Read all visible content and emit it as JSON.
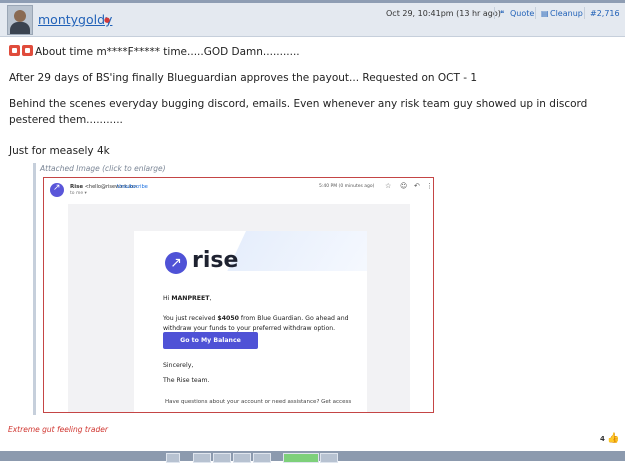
{
  "post": {
    "username": "montygoldy",
    "timestamp": "Oct 29, 10:41pm (13 hr ago)",
    "actions": {
      "quote": "Quote",
      "cleanup": "Cleanup",
      "post_number": "#2,716"
    },
    "lines": [
      "About time m****F***** time.....GOD Damn...........",
      "After 29 days of BS'ing finally Blueguardian approves the payout... Requested on OCT - 1",
      "Behind the scenes everyday bugging discord, emails. Even whenever any risk team guy showed up in discord pestered them...........",
      "Just for measely 4k"
    ],
    "attachment_label": "Attached Image (click to enlarge)",
    "signature": "Extreme gut feeling trader",
    "likes": "4"
  },
  "email": {
    "sender_name": "Rise",
    "sender_address": "<hello@risework.io>",
    "unsubscribe": "Unsubscribe",
    "to": "to me",
    "time": "5:40 PM (0 minutes ago)",
    "logo_text": "rise",
    "greeting_prefix": "Hi ",
    "greeting_name": "MANPREET",
    "greeting_suffix": ",",
    "body_prefix": "You just received ",
    "amount": "$4050",
    "body_suffix": " from Blue Guardian. Go ahead and",
    "body_line2": "withdraw your funds to your preferred withdraw option.",
    "cta": "Go to My Balance",
    "sign_off": "Sincerely,",
    "team": "The Rise team.",
    "footnote": "Have questions about your account or need assistance? Get access"
  },
  "icons": {
    "quote": "quote-icon",
    "cleanup": "cleanup-icon",
    "like": "thumbs-up-icon",
    "star": "star-icon",
    "reply": "reply-icon",
    "more": "more-icon",
    "emoji": "stop-sign-icon"
  },
  "colors": {
    "link": "#2262b8",
    "signature": "#d0352f",
    "cta": "#4f52d6",
    "header_bg": "#e4e9f0"
  }
}
